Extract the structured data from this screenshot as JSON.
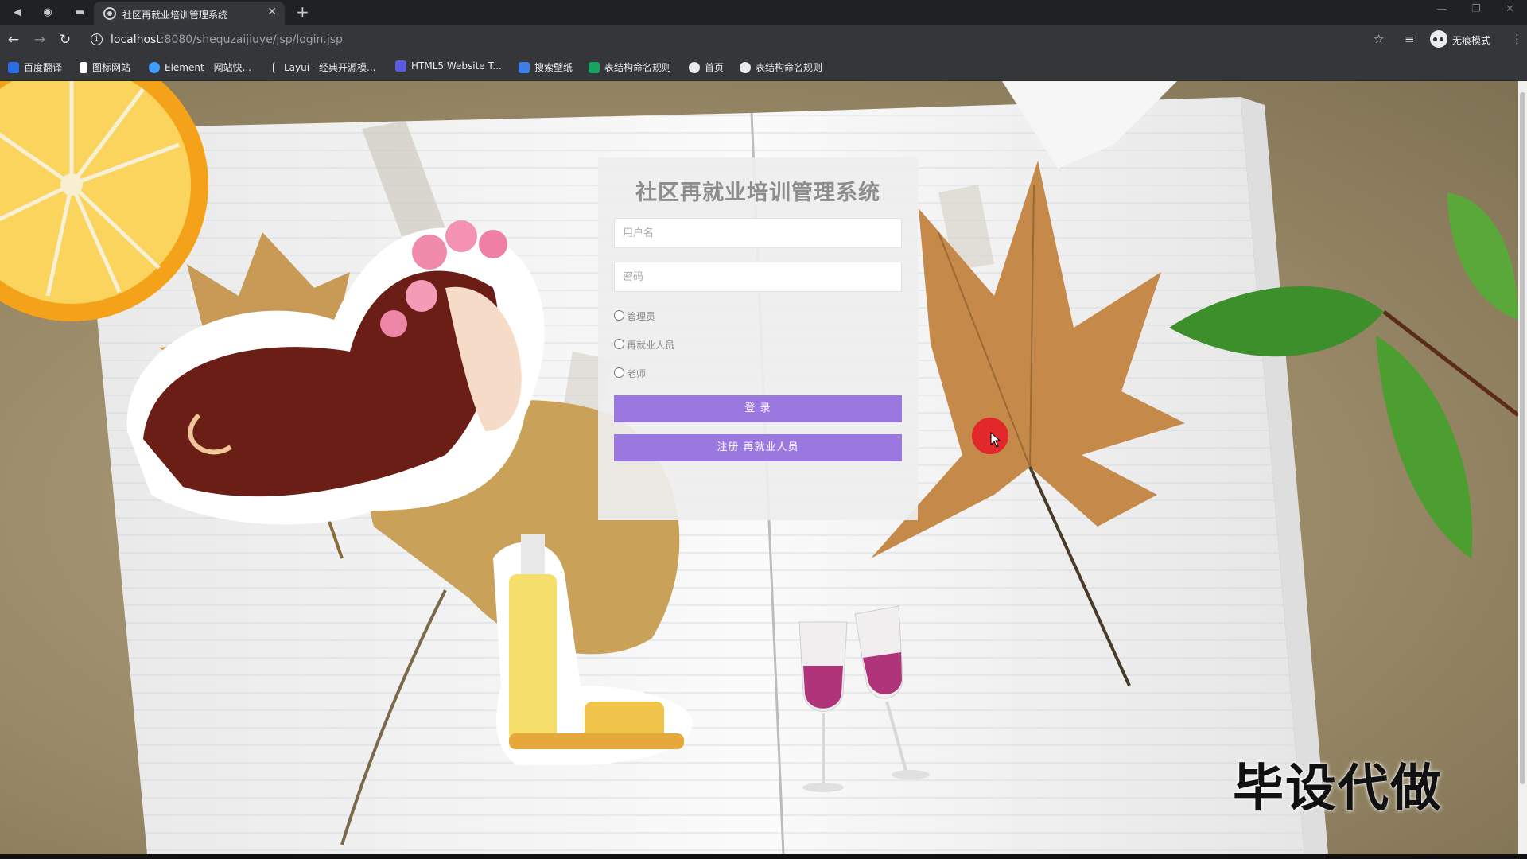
{
  "browser": {
    "tab_title": "社区再就业培训管理系统",
    "url_host": "localhost",
    "url_path": ":8080/shequzaijiuye/jsp/login.jsp",
    "incognito_label": "无痕模式",
    "bookmarks": [
      {
        "label": "百度翻译",
        "icon": "translate-icon",
        "color": "#2b6de5"
      },
      {
        "label": "图标网站",
        "icon": "flag-icon",
        "color": "#ffffff"
      },
      {
        "label": "Element - 网站快...",
        "icon": "element-icon",
        "color": "#409eff"
      },
      {
        "label": "Layui - 经典开源模...",
        "icon": "layui-icon",
        "color": "#e8eaed"
      },
      {
        "label": "HTML5 Website T...",
        "icon": "html5-icon",
        "color": "#5c5ce0"
      },
      {
        "label": "搜索壁纸",
        "icon": "wallpaper-icon",
        "color": "#3f7ee8"
      },
      {
        "label": "表结构命名规则",
        "icon": "sheet-icon",
        "color": "#1aa260"
      },
      {
        "label": "首页",
        "icon": "globe-icon",
        "color": "#e8eaed"
      },
      {
        "label": "表结构命名规则",
        "icon": "globe-icon",
        "color": "#e8eaed"
      }
    ]
  },
  "login": {
    "title": "社区再就业培训管理系统",
    "username_placeholder": "用户名",
    "password_placeholder": "密码",
    "roles": [
      "管理员",
      "再就业人员",
      "老师"
    ],
    "login_button": "登 录",
    "register_button": "注册 再就业人员",
    "accent_color": "#9b78e0"
  },
  "overlay": {
    "watermark": "毕设代做"
  }
}
